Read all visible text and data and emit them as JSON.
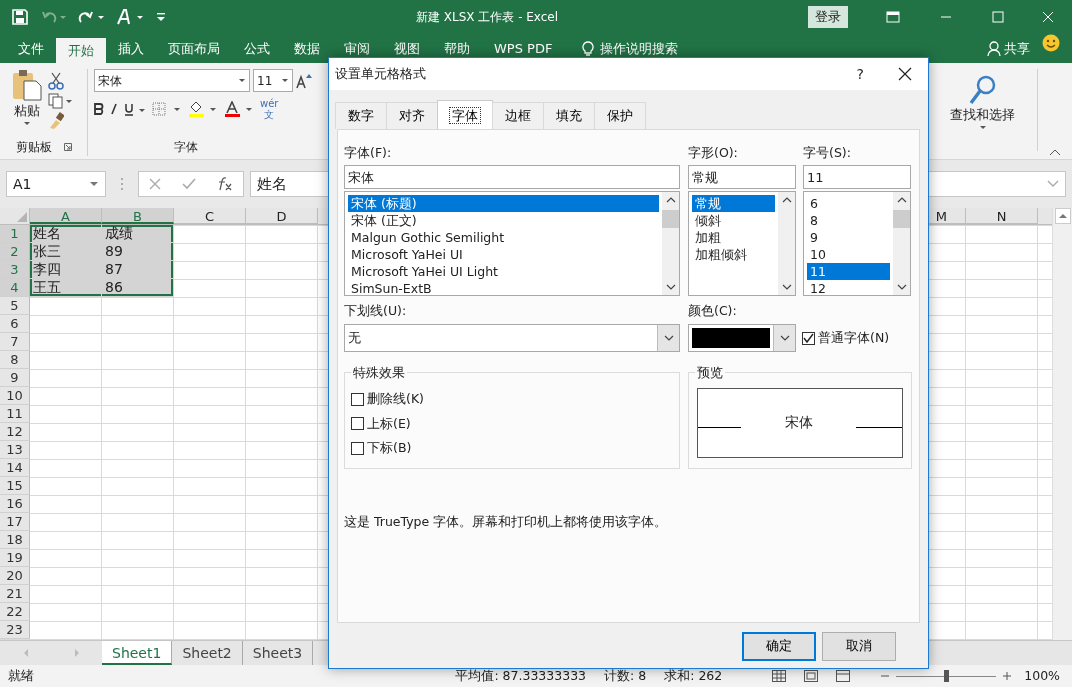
{
  "window": {
    "title": "新建 XLSX 工作表 - Excel",
    "sign_in": "登录"
  },
  "quick_access": [
    {
      "kind": "save",
      "disabled": false
    },
    {
      "kind": "undo",
      "disabled": true
    },
    {
      "kind": "redo",
      "disabled": false
    },
    {
      "kind": "touch",
      "disabled": false
    }
  ],
  "ribbon_tabs": [
    {
      "label": "文件",
      "selected": false
    },
    {
      "label": "开始",
      "selected": true
    },
    {
      "label": "插入",
      "selected": false
    },
    {
      "label": "页面布局",
      "selected": false
    },
    {
      "label": "公式",
      "selected": false
    },
    {
      "label": "数据",
      "selected": false
    },
    {
      "label": "审阅",
      "selected": false
    },
    {
      "label": "视图",
      "selected": false
    },
    {
      "label": "帮助",
      "selected": false
    },
    {
      "label": "WPS PDF",
      "selected": false
    }
  ],
  "tell_me": "操作说明搜索",
  "share": "共享",
  "clipboard": {
    "paste": "粘贴",
    "group_label": "剪贴板"
  },
  "font_group": {
    "font": "宋体",
    "size": "11",
    "group_label": "字体",
    "phonetic": [
      "wér",
      "文"
    ]
  },
  "editing": {
    "find_select": "查找和选择"
  },
  "formula_bar": {
    "name_box": "A1",
    "value": "姓名"
  },
  "columns_left": [
    {
      "label": "A",
      "selected": true
    },
    {
      "label": "B",
      "selected": true
    },
    {
      "label": "C",
      "selected": false
    },
    {
      "label": "D",
      "selected": false
    }
  ],
  "columns_right": [
    {
      "label": "M",
      "selected": false
    },
    {
      "label": "N",
      "selected": false
    }
  ],
  "rows": [
    {
      "header": "1",
      "selected": true,
      "cells": [
        "姓名",
        "成绩"
      ]
    },
    {
      "header": "2",
      "selected": true,
      "cells": [
        "张三",
        "89"
      ]
    },
    {
      "header": "3",
      "selected": true,
      "cells": [
        "李四",
        "87"
      ]
    },
    {
      "header": "4",
      "selected": true,
      "cells": [
        "王五",
        "86"
      ]
    },
    {
      "header": "5",
      "selected": false
    },
    {
      "header": "6",
      "selected": false
    },
    {
      "header": "7",
      "selected": false
    },
    {
      "header": "8",
      "selected": false
    },
    {
      "header": "9",
      "selected": false
    },
    {
      "header": "10",
      "selected": false
    },
    {
      "header": "11",
      "selected": false
    },
    {
      "header": "12",
      "selected": false
    },
    {
      "header": "13",
      "selected": false
    },
    {
      "header": "14",
      "selected": false
    },
    {
      "header": "15",
      "selected": false
    },
    {
      "header": "16",
      "selected": false
    },
    {
      "header": "17",
      "selected": false
    },
    {
      "header": "18",
      "selected": false
    },
    {
      "header": "19",
      "selected": false
    },
    {
      "header": "20",
      "selected": false
    },
    {
      "header": "21",
      "selected": false
    },
    {
      "header": "22",
      "selected": false
    },
    {
      "header": "23",
      "selected": false
    }
  ],
  "sheets": [
    {
      "label": "Sheet1",
      "selected": true
    },
    {
      "label": "Sheet2",
      "selected": false
    },
    {
      "label": "Sheet3",
      "selected": false
    }
  ],
  "status_bar": {
    "status": "就绪",
    "average": "平均值: 87.33333333",
    "count": "计数: 8",
    "sum": "求和: 262",
    "zoom": "100%",
    "zoom_slider": {
      "level": 0.5
    }
  },
  "dialog": {
    "title": "设置单元格格式",
    "help": "?",
    "tabs": [
      {
        "label": "数字",
        "selected": false
      },
      {
        "label": "对齐",
        "selected": false
      },
      {
        "label": "字体",
        "selected": true
      },
      {
        "label": "边框",
        "selected": false
      },
      {
        "label": "填充",
        "selected": false
      },
      {
        "label": "保护",
        "selected": false
      }
    ],
    "font_label": "字体(F):",
    "font_value": "宋体",
    "fonts": [
      {
        "label": "宋体 (标题)",
        "selected": true
      },
      {
        "label": "宋体 (正文)",
        "selected": false
      },
      {
        "label": "Malgun Gothic Semilight",
        "selected": false
      },
      {
        "label": "Microsoft YaHei UI",
        "selected": false
      },
      {
        "label": "Microsoft YaHei UI Light",
        "selected": false
      },
      {
        "label": "SimSun-ExtB",
        "selected": false
      }
    ],
    "style_label": "字形(O):",
    "style_value": "常规",
    "styles": [
      {
        "label": "常规",
        "selected": true
      },
      {
        "label": "倾斜",
        "selected": false
      },
      {
        "label": "加粗",
        "selected": false
      },
      {
        "label": "加粗倾斜",
        "selected": false
      }
    ],
    "size_label": "字号(S):",
    "size_value": "11",
    "sizes": [
      {
        "label": "6",
        "selected": false
      },
      {
        "label": "8",
        "selected": false
      },
      {
        "label": "9",
        "selected": false
      },
      {
        "label": "10",
        "selected": false
      },
      {
        "label": "11",
        "selected": true
      },
      {
        "label": "12",
        "selected": false
      }
    ],
    "underline_label": "下划线(U):",
    "underline_value": "无",
    "color_label": "颜色(C):",
    "color": "#000000",
    "normal_font": {
      "label": "普通字体(N)",
      "checked": true
    },
    "effects_label": "特殊效果",
    "effects": [
      {
        "label": "删除线(K)",
        "checked": false
      },
      {
        "label": "上标(E)",
        "checked": false
      },
      {
        "label": "下标(B)",
        "checked": false
      }
    ],
    "preview_label": "预览",
    "preview_text": "宋体",
    "description": "这是 TrueType 字体。屏幕和打印机上都将使用该字体。",
    "buttons": [
      {
        "label": "确定",
        "kind": "primary"
      },
      {
        "label": "取消",
        "kind": "secondary"
      }
    ]
  }
}
